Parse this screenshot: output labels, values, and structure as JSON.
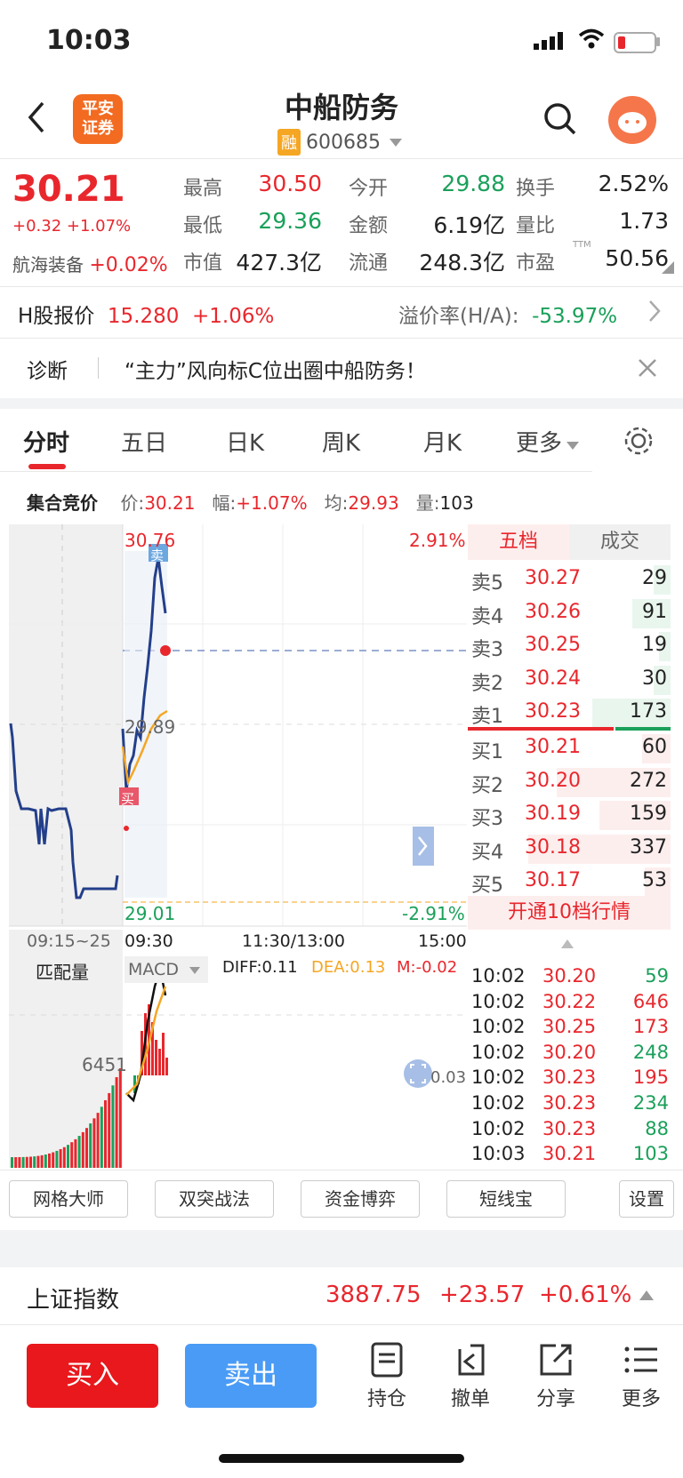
{
  "status": {
    "time": "10:03"
  },
  "header": {
    "title": "中船防务",
    "rong": "融",
    "code": "600685",
    "logo_line1": "平安",
    "logo_line2": "证券"
  },
  "quote": {
    "price": "30.21",
    "change": "+0.32 +1.07%",
    "sector_name": "航海装备",
    "sector_change": "+0.02%"
  },
  "stats": [
    {
      "label": "最高",
      "value": "30.50",
      "color": "red"
    },
    {
      "label": "今开",
      "value": "29.88",
      "color": "green"
    },
    {
      "label": "换手",
      "value": "2.52%",
      "color": "black"
    },
    {
      "label": "最低",
      "value": "29.36",
      "color": "green"
    },
    {
      "label": "金额",
      "value": "6.19亿",
      "color": "black"
    },
    {
      "label": "量比",
      "value": "1.73",
      "color": "black"
    },
    {
      "label": "市值",
      "value": "427.3亿",
      "color": "black"
    },
    {
      "label": "流通",
      "value": "248.3亿",
      "color": "black"
    },
    {
      "label": "市盈",
      "value": "50.56",
      "color": "black",
      "sup": "TTM"
    }
  ],
  "hshare": {
    "label": "H股报价",
    "price": "15.280",
    "change": "+1.06%",
    "premium_label": "溢价率(H/A):",
    "premium_value": "-53.97%"
  },
  "diagnosis": {
    "label": "诊断",
    "text": "“主力”风向标C位出圈中船防务！"
  },
  "tabs": [
    "分时",
    "五日",
    "日K",
    "周K",
    "月K",
    "更多"
  ],
  "auction": {
    "title": "集合竞价",
    "price_label": "价:",
    "price": "30.21",
    "amp_label": "幅:",
    "amp": "+1.07%",
    "avg_label": "均:",
    "avg": "29.93",
    "vol_label": "量:",
    "vol": "103"
  },
  "chart": {
    "top_price": "30.76",
    "top_pct": "2.91%",
    "mid_price": "29.89",
    "bottom_price": "29.01",
    "bottom_pct": "-2.91%",
    "time_labels": [
      "09:15~25",
      "09:30",
      "11:30/13:00",
      "15:00"
    ],
    "sell_tag": "卖",
    "buy_tag": "买",
    "vol_title": "匹配量",
    "vol_value": "6451",
    "macd_label": "MACD",
    "diff": "DIFF:0.11",
    "dea": "DEA:0.13",
    "m": "M:-0.02",
    "macd_axis": "0.03"
  },
  "orderbook": {
    "tab_active": "五档",
    "tab_other": "成交",
    "asks": [
      {
        "label": "卖5",
        "price": "30.27",
        "vol": "29",
        "bar": 0.12
      },
      {
        "label": "卖4",
        "price": "30.26",
        "vol": "91",
        "bar": 0.27
      },
      {
        "label": "卖3",
        "price": "30.25",
        "vol": "19",
        "bar": 0.08
      },
      {
        "label": "卖2",
        "price": "30.24",
        "vol": "30",
        "bar": 0.12
      },
      {
        "label": "卖1",
        "price": "30.23",
        "vol": "173",
        "bar": 0.55
      }
    ],
    "bids": [
      {
        "label": "买1",
        "price": "30.21",
        "vol": "60",
        "bar": 0.2
      },
      {
        "label": "买2",
        "price": "30.20",
        "vol": "272",
        "bar": 0.8
      },
      {
        "label": "买3",
        "price": "30.19",
        "vol": "159",
        "bar": 0.5
      },
      {
        "label": "买4",
        "price": "30.18",
        "vol": "337",
        "bar": 1.0
      },
      {
        "label": "买5",
        "price": "30.17",
        "vol": "53",
        "bar": 0.18
      }
    ],
    "upgrade_text": "开通10档行情",
    "trades": [
      {
        "time": "10:02",
        "price": "30.20",
        "vol": "59",
        "dir": "green"
      },
      {
        "time": "10:02",
        "price": "30.22",
        "vol": "646",
        "dir": "red"
      },
      {
        "time": "10:02",
        "price": "30.25",
        "vol": "173",
        "dir": "red"
      },
      {
        "time": "10:02",
        "price": "30.20",
        "vol": "248",
        "dir": "green"
      },
      {
        "time": "10:02",
        "price": "30.23",
        "vol": "195",
        "dir": "red"
      },
      {
        "time": "10:02",
        "price": "30.23",
        "vol": "234",
        "dir": "green"
      },
      {
        "time": "10:02",
        "price": "30.23",
        "vol": "88",
        "dir": "green"
      },
      {
        "time": "10:03",
        "price": "30.21",
        "vol": "103",
        "dir": "green"
      }
    ]
  },
  "tools": {
    "btn1": "网格大师",
    "btn2": "双突战法",
    "btn3": "资金博弈",
    "btn4": "短线宝",
    "settings": "设置"
  },
  "index": {
    "name": "上证指数",
    "value": "3887.75",
    "change": "+23.57",
    "pct": "+0.61%"
  },
  "actions": {
    "buy": "买入",
    "sell": "卖出",
    "hold": "持仓",
    "cancel": "撤单",
    "share": "分享",
    "more": "更多"
  }
}
